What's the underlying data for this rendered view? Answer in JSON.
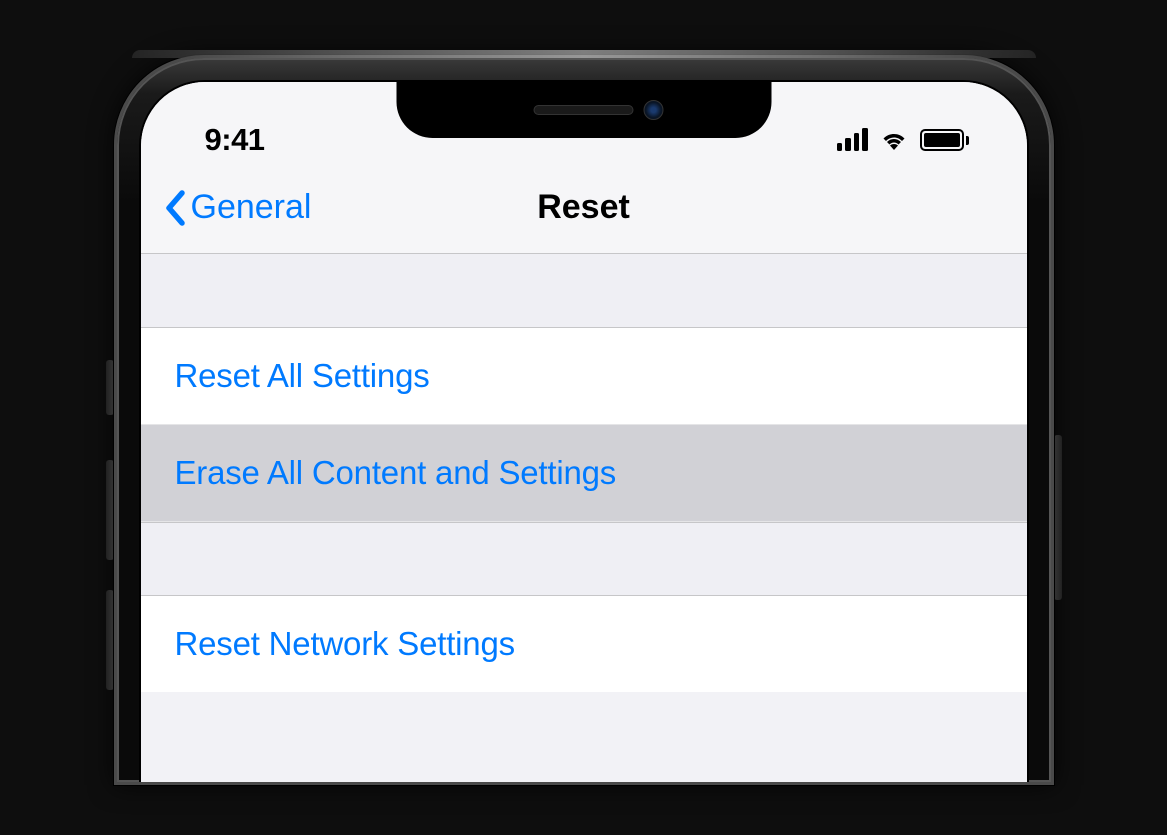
{
  "status": {
    "time": "9:41"
  },
  "nav": {
    "back_label": "General",
    "title": "Reset"
  },
  "sections": [
    {
      "items": [
        {
          "label": "Reset All Settings",
          "highlighted": false
        },
        {
          "label": "Erase All Content and Settings",
          "highlighted": true
        }
      ]
    },
    {
      "items": [
        {
          "label": "Reset Network Settings",
          "highlighted": false
        }
      ]
    }
  ],
  "colors": {
    "link": "#007aff",
    "background": "#efeff4",
    "cell": "#ffffff",
    "highlight": "#d1d1d6"
  }
}
